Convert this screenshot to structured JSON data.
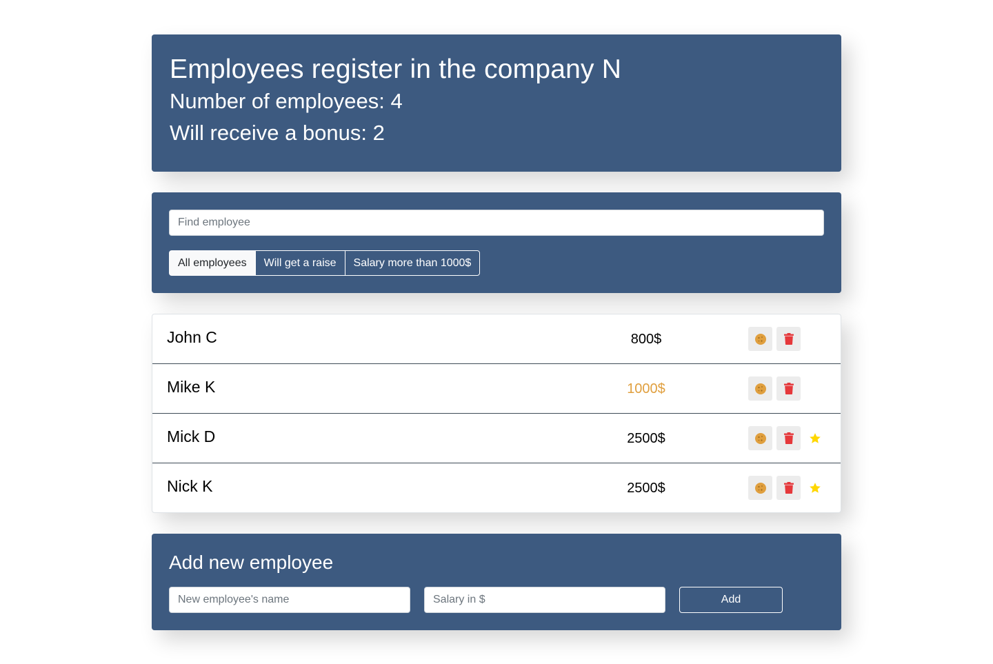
{
  "header": {
    "title": "Employees register in the company N",
    "employees_count_text": "Number of employees: 4",
    "bonus_count_text": "Will receive a bonus: 2"
  },
  "search": {
    "placeholder": "Find employee"
  },
  "filters": [
    {
      "label": "All employees",
      "active": true
    },
    {
      "label": "Will get a raise",
      "active": false
    },
    {
      "label": "Salary more than 1000$",
      "active": false
    }
  ],
  "employees": [
    {
      "name": "John C",
      "salary": "800$",
      "increase": false,
      "rise": false
    },
    {
      "name": "Mike K",
      "salary": "1000$",
      "increase": true,
      "rise": false
    },
    {
      "name": "Mick D",
      "salary": "2500$",
      "increase": false,
      "rise": true
    },
    {
      "name": "Nick K",
      "salary": "2500$",
      "increase": false,
      "rise": true
    }
  ],
  "add_form": {
    "title": "Add new employee",
    "name_placeholder": "New employee's name",
    "salary_placeholder": "Salary in $",
    "submit_label": "Add"
  },
  "icons": {
    "cookie": "cookie-icon",
    "trash": "trash-icon",
    "star": "star-icon"
  },
  "colors": {
    "panel": "#3d5a80",
    "increase_salary": "#e09f3e",
    "cookie": "#e09f3e",
    "trash": "#e5383b",
    "star": "#ffd700"
  }
}
